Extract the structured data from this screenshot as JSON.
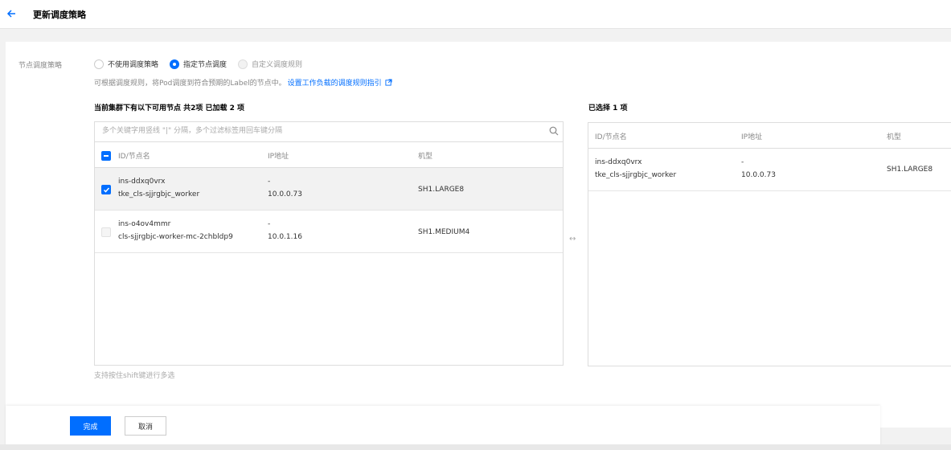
{
  "header": {
    "title": "更新调度策略"
  },
  "strategy": {
    "label": "节点调度策略",
    "options": [
      {
        "label": "不使用调度策略",
        "state": "unchecked"
      },
      {
        "label": "指定节点调度",
        "state": "checked"
      },
      {
        "label": "自定义调度规则",
        "state": "disabled"
      }
    ],
    "hint": "可根据调度规则，将Pod调度到符合预期的Label的节点中。",
    "hint_link": "设置工作负载的调度规则指引"
  },
  "left": {
    "title": "当前集群下有以下可用节点 共2项 已加载 2 项",
    "search_placeholder": "多个关键字用竖线 \"|\" 分隔，多个过滤标签用回车键分隔",
    "columns": [
      "ID/节点名",
      "IP地址",
      "机型"
    ],
    "rows": [
      {
        "id": "ins-ddxq0vrx",
        "name": "tke_cls-sjjrgbjc_worker",
        "ip_top": "-",
        "ip": "10.0.0.73",
        "type": "SH1.LARGE8",
        "checked": true
      },
      {
        "id": "ins-o4ov4mmr",
        "name": "cls-sjjrgbjc-worker-mc-2chbldp9",
        "ip_top": "-",
        "ip": "10.0.1.16",
        "type": "SH1.MEDIUM4",
        "checked": false
      }
    ],
    "footer_hint": "支持按住shift键进行多选"
  },
  "transfer_icon": "↔",
  "right": {
    "title": "已选择 1 项",
    "columns": [
      "ID/节点名",
      "IP地址",
      "机型"
    ],
    "rows": [
      {
        "id": "ins-ddxq0vrx",
        "name": "tke_cls-sjjrgbjc_worker",
        "ip_top": "-",
        "ip": "10.0.0.73",
        "type": "SH1.LARGE8"
      }
    ]
  },
  "actions": {
    "confirm": "完成",
    "cancel": "取消"
  },
  "colors": {
    "primary": "#006eff",
    "muted": "#888888"
  }
}
